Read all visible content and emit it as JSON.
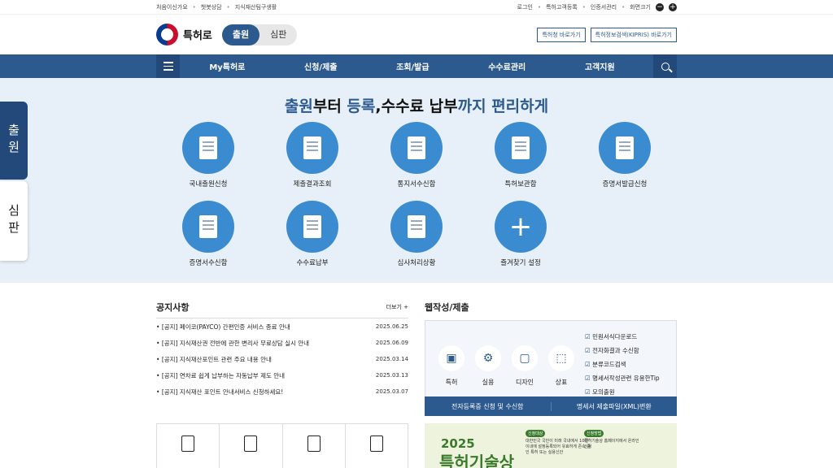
{
  "topbar": {
    "left": [
      "처음이신가요",
      "챗봇상담",
      "지식재산팀구생활"
    ],
    "right": [
      "로그인",
      "특허고객등록",
      "인증서관리",
      "화면크기"
    ],
    "zoom_minus": "−",
    "zoom_plus": "+"
  },
  "header": {
    "logo": "특허로",
    "tabs": [
      "출원",
      "심판"
    ],
    "btn1": "특허청 바로가기",
    "btn2": "특허정보검색(KIPRIS) 바로가기"
  },
  "nav": {
    "items": [
      "My특허로",
      "신청/제출",
      "조회/발급",
      "수수료관리",
      "고객지원"
    ]
  },
  "hero": {
    "title_parts": [
      "출원",
      "부터 ",
      "등록",
      ",",
      "수수료 납부",
      "까지 편리하게"
    ],
    "services": [
      "국내출원신청",
      "제출결과조회",
      "통지서수신함",
      "특허보관함",
      "증명서발급신청",
      "증명서수신함",
      "수수료납부",
      "심사처리상황",
      "즐겨찾기 설정"
    ]
  },
  "sidetabs": [
    "출원",
    "심판"
  ],
  "notice": {
    "title": "공지사항",
    "more": "더보기 +",
    "items": [
      {
        "text": "[공지] 페이코(PAYCO) 간편인증 서비스 종료 안내",
        "date": "2025.06.25"
      },
      {
        "text": "[공지] 지식재산권 전반에 관한 변리사 무료상담 실시 안내",
        "date": "2025.06.09"
      },
      {
        "text": "[공지] 지식재산포인트 관련 주요 내용 안내",
        "date": "2025.03.14"
      },
      {
        "text": "[공지] 연차료 쉽게 납부하는 자동납부 제도 안내",
        "date": "2025.03.13"
      },
      {
        "text": "[공지] 지식재산 포인트 안내서비스 신청하세요!",
        "date": "2025.03.07"
      }
    ]
  },
  "web": {
    "title": "웹작성/제출",
    "icons": [
      "특허",
      "실용",
      "디자인",
      "상표"
    ],
    "links": [
      "민원서식다운로드",
      "전자화결과 수신함",
      "분류코드검색",
      "명세서작성관련 유용한Tip",
      "모의출원"
    ],
    "bar": [
      "전자등록증 신청 및 수신함",
      "명세서 제출파일(XML)변환"
    ]
  },
  "banner": {
    "year": "2025",
    "title": "특허기술상",
    "chip1": "신청대상",
    "chip2": "신청방법",
    "text1": "대한민국 국민이 미래 국내에서 10년이내에 설정등록되어 유효하게 존속 중인 특허 또는 실용신안",
    "text2": "특허기술상 홈페이지에서 온라인 신청"
  }
}
